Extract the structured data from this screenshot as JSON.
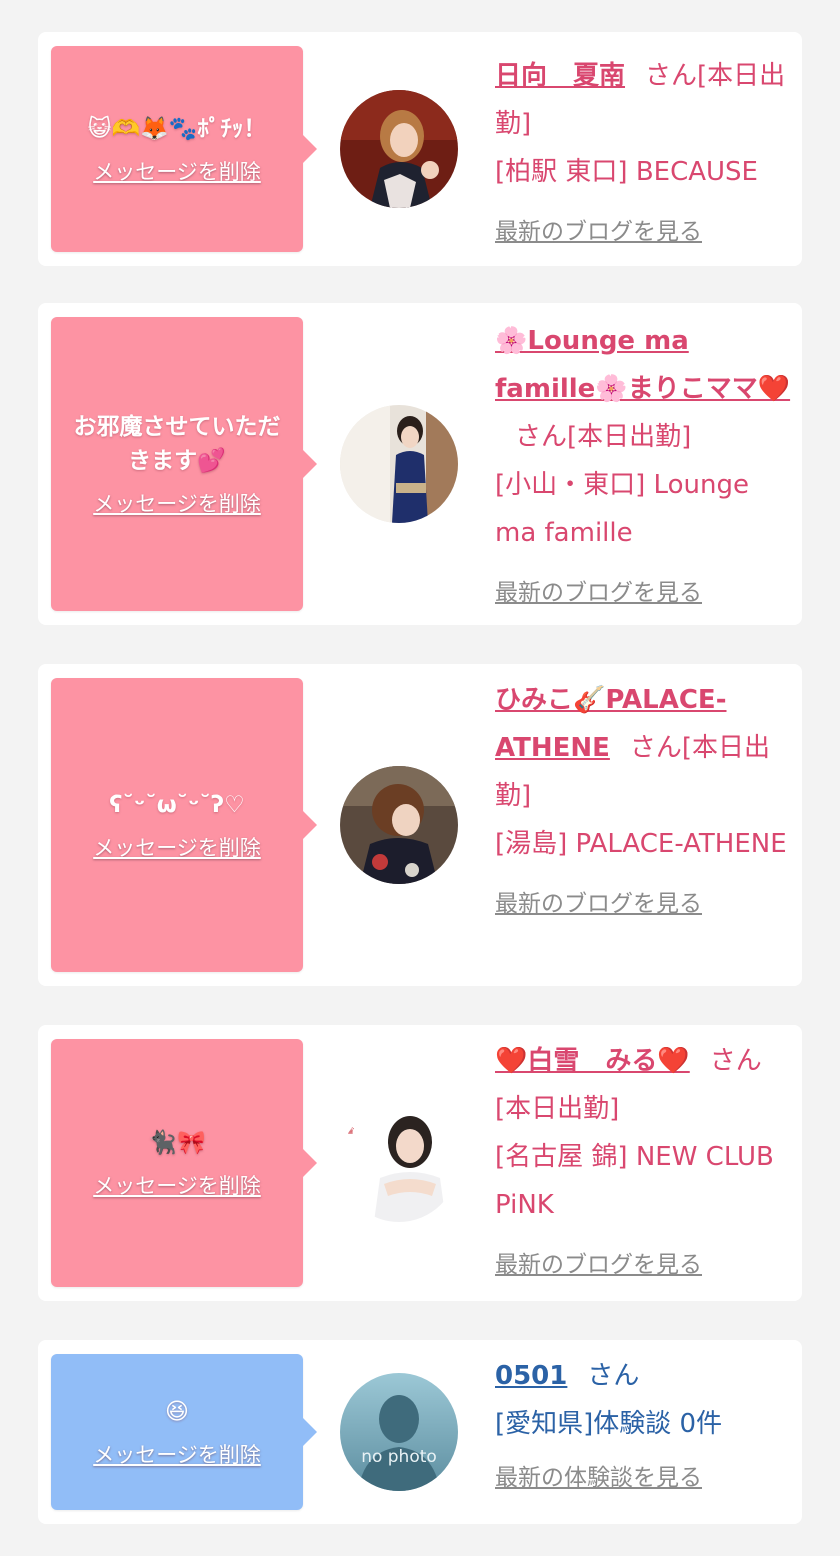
{
  "cards": [
    {
      "message": "😺🫶🦊🐾ﾎﾟﾁｯ！",
      "delete_label": "メッセージを削除",
      "name": "日向　夏南",
      "san": "さん[本日出勤]",
      "shop": "[柏駅 東口] BECAUSE",
      "more_label": "最新のブログを見る"
    },
    {
      "message": "お邪魔させていただきます💕",
      "delete_label": "メッセージを削除",
      "name": "🌸Lounge ma famille🌸まりこママ❤️",
      "san": "さん[本日出勤]",
      "shop": "[小山・東口] Lounge ma famille",
      "more_label": "最新のブログを見る"
    },
    {
      "message": "ʕ˘ᵕ˘ω˘ᵕ˘ʔ♡",
      "delete_label": "メッセージを削除",
      "name": "ひみこ🎸PALACE-ATHENE",
      "san": "さん[本日出勤]",
      "shop": "[湯島] PALACE-ATHENE",
      "more_label": "最新のブログを見る"
    },
    {
      "message": "🐈‍⬛🎀",
      "delete_label": "メッセージを削除",
      "name": "❤️白雪　みる❤️",
      "san": "さん[本日出勤]",
      "shop": "[名古屋 錦] NEW CLUB PiNK",
      "more_label": "最新のブログを見る"
    },
    {
      "message": "😆",
      "delete_label": "メッセージを削除",
      "name": "0501",
      "san": "さん",
      "shop": "[愛知県]体験談 0件",
      "more_label": "最新の体験談を見る",
      "avatar_text": "no photo"
    }
  ],
  "colors": {
    "pink_bubble": "#fd93a3",
    "blue_bubble": "#91bdf7",
    "pink_text": "#d9476f",
    "blue_text": "#2b62a6",
    "link_gray": "#8b8b8b",
    "background": "#f3f3f3"
  }
}
